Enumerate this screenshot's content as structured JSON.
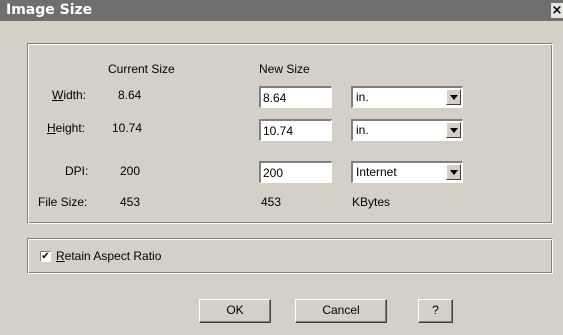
{
  "window": {
    "title": "Image Size",
    "close_label": "×"
  },
  "columns": {
    "current": "Current Size",
    "new": "New Size"
  },
  "rows": {
    "width": {
      "label": "Width:",
      "current": "8.64",
      "new_value": "8.64",
      "unit": "in."
    },
    "height": {
      "label": "Height:",
      "current": "10.74",
      "new_value": "10.74",
      "unit": "in."
    },
    "dpi": {
      "label": "DPI:",
      "current": "200",
      "new_value": "200",
      "unit": "Internet"
    },
    "filesize": {
      "label": "File Size:",
      "current": "453",
      "new": "453",
      "unit": "KBytes"
    }
  },
  "options": {
    "retain_aspect_label": "Retain Aspect Ratio",
    "retain_aspect_checked": true
  },
  "buttons": {
    "ok": "OK",
    "cancel": "Cancel",
    "help": "?"
  }
}
